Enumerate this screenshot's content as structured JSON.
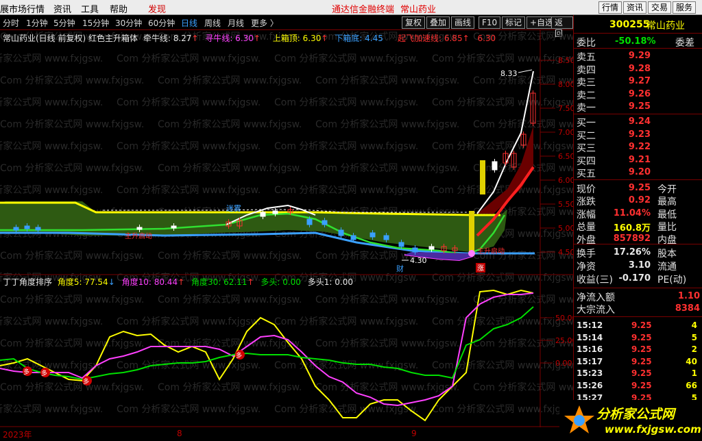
{
  "menubar": {
    "items": [
      "展市场行情",
      "资讯",
      "工具",
      "帮助"
    ],
    "discover": "发现",
    "banner_left": "通达信金融终端",
    "banner_right": "常山药业",
    "buttons": [
      "行情",
      "资讯",
      "交易",
      "服务"
    ]
  },
  "periods": {
    "items": [
      "分时",
      "1分钟",
      "5分钟",
      "15分钟",
      "30分钟",
      "60分钟",
      "日线",
      "周线",
      "月线",
      "更多 〉"
    ],
    "active": "日线"
  },
  "toolbar": {
    "buttons": [
      "复权",
      "叠加",
      "画线",
      "F10",
      "标记",
      "+自选",
      "返回"
    ]
  },
  "main_indicator": {
    "name": "常山药业(日线 前复权)",
    "indicator": "红色主升箱体",
    "qianniu": "牵牛线: 8.27",
    "xunniu": "寻牛线: 6.30",
    "shangxiang": "上箱顶: 6.30",
    "xiaxiang": "下箱底: 4.45",
    "qifei": "起飞加速线: 6.85",
    "last_val": "6.30"
  },
  "sub_indicator": {
    "name": "丁丁角度排序",
    "a5": "角度5: 77.54",
    "a10": "角度10: 80.44",
    "a30": "角度30: 62.11",
    "duotou": "多头: 0.00",
    "duotou1": "多头1: 0.00"
  },
  "chart_data": {
    "type": "line",
    "candles": {
      "dates_shown": [
        "2023年",
        "8",
        "9"
      ],
      "high_label": "8.33",
      "low_label": "4.30",
      "y_axis_ticks": [
        4.5,
        5.0,
        5.5,
        6.0,
        6.5,
        7.0,
        7.5,
        8.0,
        8.5
      ],
      "annotations": [
        "迷雾",
        "主升启动",
        "财",
        "涨"
      ]
    },
    "oscillator": {
      "y_axis_ticks": [
        0.0,
        25.0,
        50.0
      ],
      "series": [
        {
          "name": "角度5",
          "color": "#ffff00"
        },
        {
          "name": "角度10",
          "color": "#ff40ff"
        },
        {
          "name": "角度30",
          "color": "#00e000"
        }
      ],
      "markers": [
        "多",
        "多",
        "多",
        "多"
      ]
    }
  },
  "quote": {
    "code": "300255",
    "name": "常山药业",
    "weibi_label": "委比",
    "weibi_value": "-50.18%",
    "weicha_label": "委差",
    "asks": [
      {
        "label": "卖五",
        "price": "9.29"
      },
      {
        "label": "卖四",
        "price": "9.28"
      },
      {
        "label": "卖三",
        "price": "9.27"
      },
      {
        "label": "卖二",
        "price": "9.26"
      },
      {
        "label": "卖一",
        "price": "9.25"
      }
    ],
    "bids": [
      {
        "label": "买一",
        "price": "9.24"
      },
      {
        "label": "买二",
        "price": "9.23"
      },
      {
        "label": "买三",
        "price": "9.22"
      },
      {
        "label": "买四",
        "price": "9.21"
      },
      {
        "label": "买五",
        "price": "9.20"
      }
    ],
    "stats": [
      {
        "l1": "现价",
        "v1": "9.25",
        "l2": "今开"
      },
      {
        "l1": "涨跌",
        "v1": "0.92",
        "l2": "最高"
      },
      {
        "l1": "涨幅",
        "v1": "11.04%",
        "l2": "最低"
      },
      {
        "l1": "总量",
        "v1": "160.8万",
        "l2": "量比"
      },
      {
        "l1": "外盘",
        "v1": "857892",
        "l2": "内盘"
      }
    ],
    "stats2": [
      {
        "l1": "换手",
        "v1": "17.26%",
        "l2": "股本"
      },
      {
        "l1": "净资",
        "v1": "3.10",
        "l2": "流通"
      },
      {
        "l1": "收益(三)",
        "v1": "-0.170",
        "l2": "PE(动)"
      }
    ],
    "flow": [
      {
        "label": "净流入额",
        "value": "1.10"
      },
      {
        "label": "大宗流入",
        "value": "8384"
      }
    ],
    "ticks": [
      {
        "time": "15:12",
        "price": "9.25",
        "vol": "4"
      },
      {
        "time": "15:14",
        "price": "9.25",
        "vol": "5"
      },
      {
        "time": "15:16",
        "price": "9.25",
        "vol": "2"
      },
      {
        "time": "15:17",
        "price": "9.25",
        "vol": "40"
      },
      {
        "time": "15:23",
        "price": "9.25",
        "vol": "1"
      },
      {
        "time": "15:26",
        "price": "9.25",
        "vol": "66"
      },
      {
        "time": "15:27",
        "price": "9.25",
        "vol": "5"
      }
    ]
  },
  "logo": {
    "text": "分析家公式网",
    "url": "www.fxjgsw.com"
  },
  "watermark": "Com 分析家公式网 www.fxjgsw."
}
